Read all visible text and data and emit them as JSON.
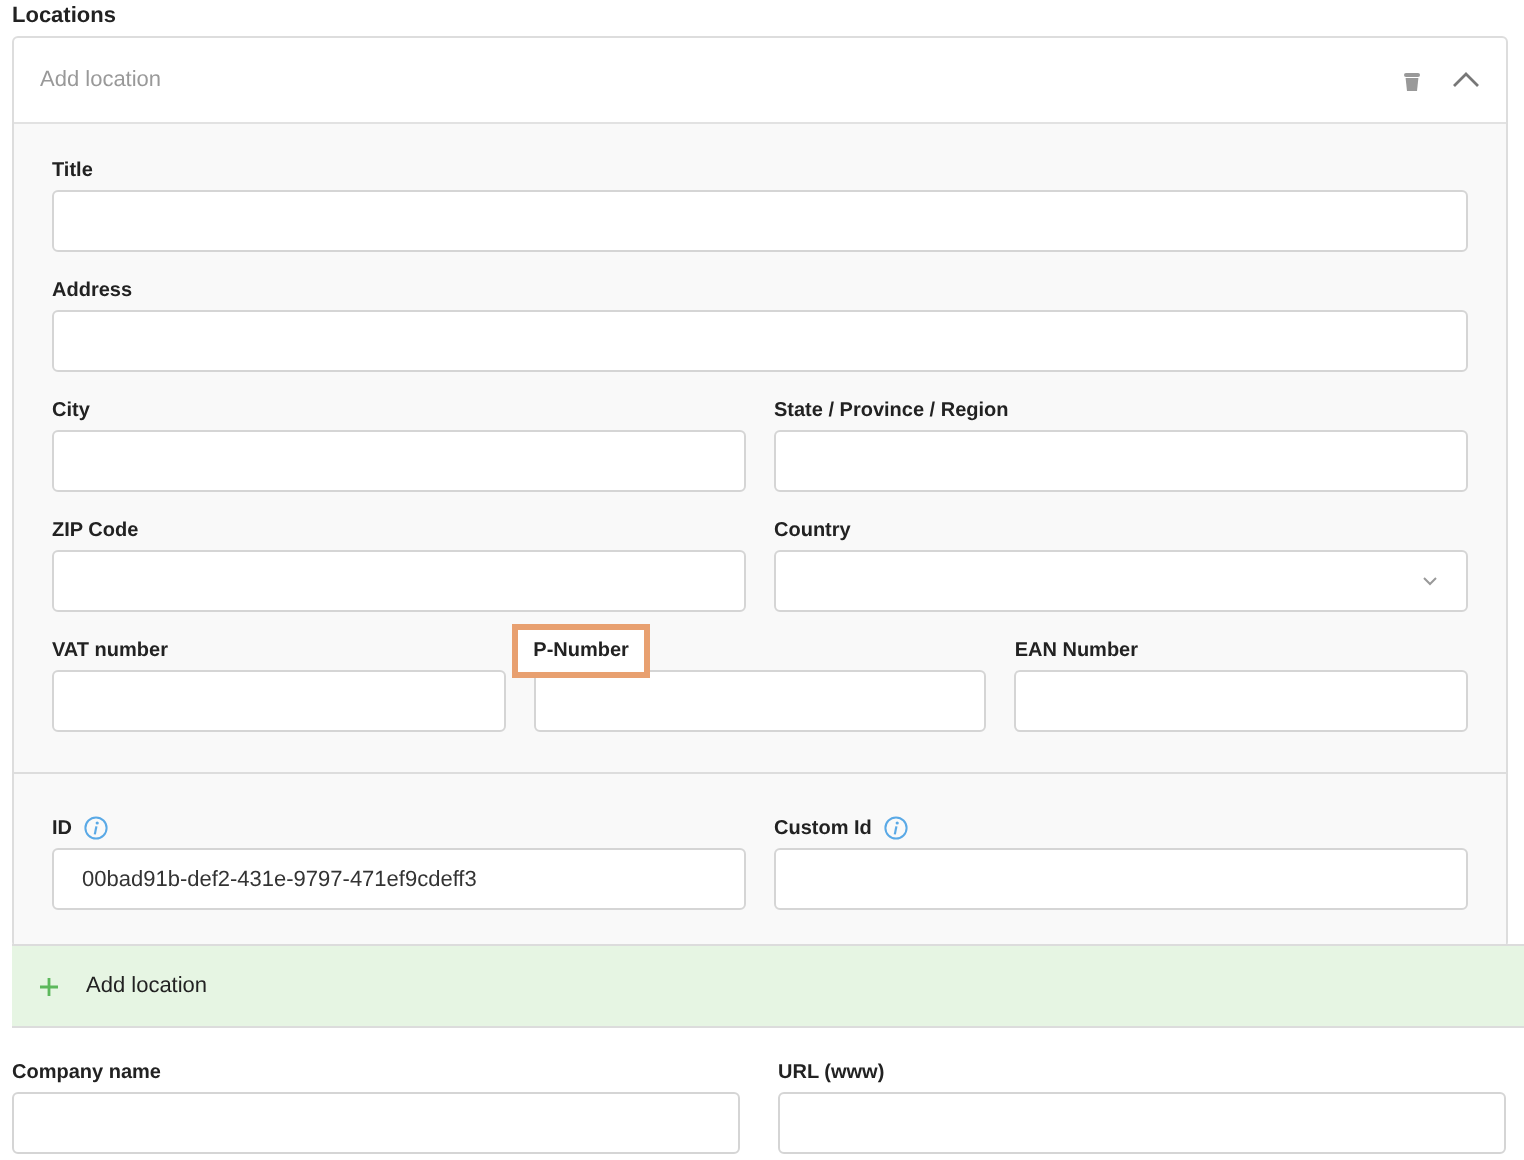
{
  "section_title": "Locations",
  "location": {
    "header": "Add location",
    "expanded": true,
    "groups": [
      {
        "rows": [
          [
            {
              "label": "Title",
              "kind": "text",
              "info": false,
              "highlighted": false
            }
          ],
          [
            {
              "label": "Address",
              "kind": "text",
              "info": false,
              "highlighted": false
            }
          ],
          [
            {
              "label": "City",
              "kind": "text",
              "info": false,
              "highlighted": false
            },
            {
              "label": "State / Province / Region",
              "kind": "text",
              "info": false,
              "highlighted": false
            }
          ],
          [
            {
              "label": "ZIP Code",
              "kind": "text",
              "info": false,
              "highlighted": false
            },
            {
              "label": "Country",
              "kind": "select",
              "info": false,
              "highlighted": false
            }
          ],
          [
            {
              "label": "VAT number",
              "kind": "text",
              "info": false,
              "highlighted": false
            },
            {
              "label": "P-Number",
              "kind": "text",
              "info": false,
              "highlighted": true
            },
            {
              "label": "EAN Number",
              "kind": "text",
              "info": false,
              "highlighted": false
            }
          ]
        ]
      },
      {
        "rows": [
          [
            {
              "label": "ID",
              "kind": "text",
              "value": "00bad91b-def2-431e-9797-471ef9cdeff3",
              "info": true,
              "highlighted": false
            },
            {
              "label": "Custom Id",
              "kind": "text",
              "info": true,
              "highlighted": false
            }
          ]
        ]
      }
    ]
  },
  "add_button": "Add location",
  "fields": [
    {
      "label": "Company name",
      "kind": "text"
    },
    {
      "label": "URL (www)",
      "kind": "text"
    }
  ]
}
